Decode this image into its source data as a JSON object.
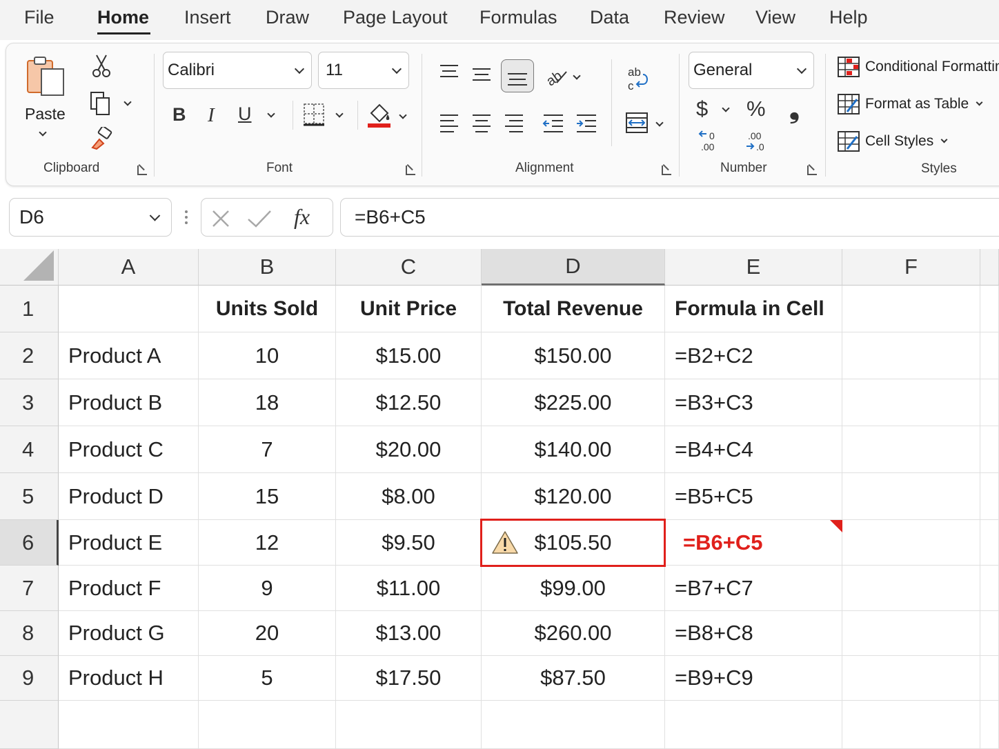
{
  "menu": {
    "tabs": [
      "File",
      "Home",
      "Insert",
      "Draw",
      "Page Layout",
      "Formulas",
      "Data",
      "Review",
      "View",
      "Help"
    ],
    "active": "Home"
  },
  "ribbon": {
    "clipboard": {
      "paste_label": "Paste",
      "group_label": "Clipboard"
    },
    "font": {
      "font_name": "Calibri",
      "font_size": "11",
      "bold": "B",
      "italic": "I",
      "underline": "U",
      "group_label": "Font",
      "fill_color": "#e0201b"
    },
    "alignment": {
      "group_label": "Alignment"
    },
    "number": {
      "format": "General",
      "currency": "$",
      "percent": "%",
      "comma": "❟",
      "group_label": "Number"
    },
    "styles": {
      "conditional_formatting": "Conditional Formattin",
      "format_as_table": "Format as Table",
      "cell_styles": "Cell Styles",
      "group_label": "Styles"
    }
  },
  "formula_bar": {
    "name_box": "D6",
    "fx": "fx",
    "formula": "=B6+C5"
  },
  "grid": {
    "columns": [
      "A",
      "B",
      "C",
      "D",
      "E",
      "F"
    ],
    "selected_column": "D",
    "selected_row": "6",
    "header_row": [
      "",
      "Units Sold",
      "Unit Price",
      "Total Revenue",
      "Formula in Cell"
    ],
    "rows": [
      [
        "Product A",
        "10",
        "$15.00",
        "$150.00",
        "=B2+C2"
      ],
      [
        "Product B",
        "18",
        "$12.50",
        "$225.00",
        "=B3+C3"
      ],
      [
        "Product C",
        "7",
        "$20.00",
        "$140.00",
        "=B4+C4"
      ],
      [
        "Product D",
        "15",
        "$8.00",
        "$120.00",
        "=B5+C5"
      ],
      [
        "Product E",
        "12",
        "$9.50",
        "$105.50",
        "=B6+C5"
      ],
      [
        "Product F",
        "9",
        "$11.00",
        "$99.00",
        "=B7+C7"
      ],
      [
        "Product G",
        "20",
        "$13.00",
        "$260.00",
        "=B8+C8"
      ],
      [
        "Product H",
        "5",
        "$17.50",
        "$87.50",
        "=B9+C9"
      ]
    ],
    "row_numbers": [
      "1",
      "2",
      "3",
      "4",
      "5",
      "6",
      "7",
      "8",
      "9"
    ],
    "error_color": "#e0201b"
  }
}
